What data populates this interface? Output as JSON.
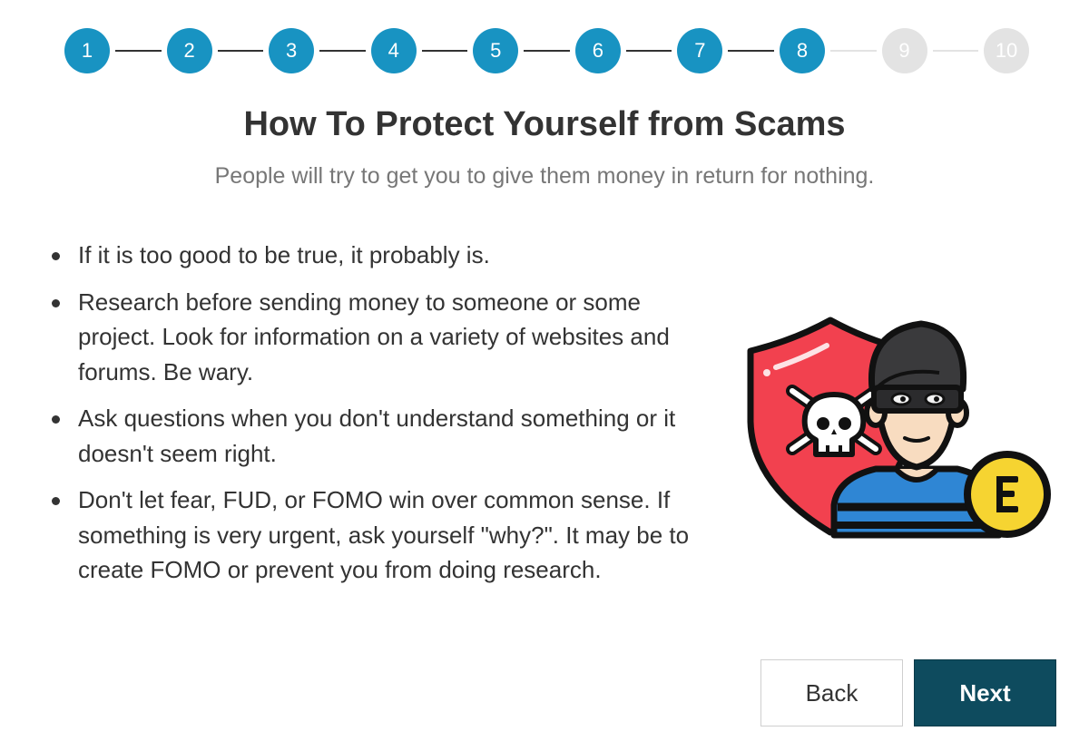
{
  "stepper": {
    "steps": [
      {
        "label": "1",
        "state": "done"
      },
      {
        "label": "2",
        "state": "done"
      },
      {
        "label": "3",
        "state": "done"
      },
      {
        "label": "4",
        "state": "done"
      },
      {
        "label": "5",
        "state": "done"
      },
      {
        "label": "6",
        "state": "done"
      },
      {
        "label": "7",
        "state": "done"
      },
      {
        "label": "8",
        "state": "done"
      },
      {
        "label": "9",
        "state": "todo"
      },
      {
        "label": "10",
        "state": "todo"
      }
    ],
    "active_color": "#1893c2",
    "inactive_color": "#e3e3e3"
  },
  "content": {
    "title": "How To Protect Yourself from Scams",
    "subtitle": "People will try to get you to give them money in return for nothing.",
    "bullets": [
      "If it is too good to be true, it probably is.",
      "Research before sending money to someone or some project. Look for information on a variety of websites and forums. Be wary.",
      "Ask questions when you don't understand something or it doesn't seem right.",
      "Don't let fear, FUD, or FOMO win over common sense. If something is very urgent, ask yourself \"why?\". It may be to create FOMO or prevent you from doing research."
    ],
    "illustration_icon": "scammer-shield-skull-coin-icon"
  },
  "buttons": {
    "back_label": "Back",
    "next_label": "Next",
    "next_color": "#0e4b5e"
  }
}
